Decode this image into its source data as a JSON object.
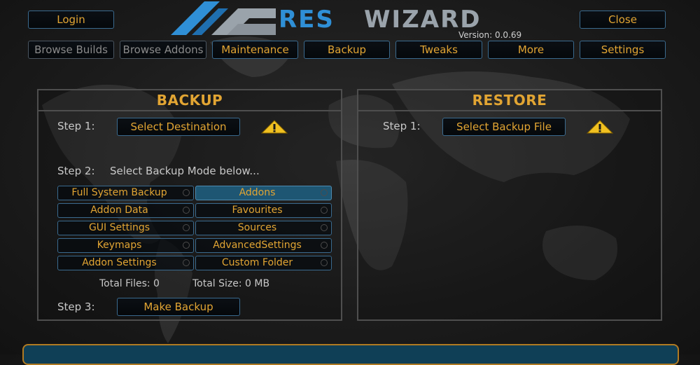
{
  "app": {
    "logo_left": "RES",
    "logo_right": "WIZARD",
    "version": "Version: 0.0.69"
  },
  "header": {
    "login_label": "Login",
    "close_label": "Close"
  },
  "nav": [
    {
      "label": "Browse Builds",
      "enabled": false
    },
    {
      "label": "Browse Addons",
      "enabled": false
    },
    {
      "label": "Maintenance",
      "enabled": true
    },
    {
      "label": "Backup",
      "enabled": true
    },
    {
      "label": "Tweaks",
      "enabled": true
    },
    {
      "label": "More",
      "enabled": true
    },
    {
      "label": "Settings",
      "enabled": true
    }
  ],
  "backup": {
    "title": "BACKUP",
    "step1_label": "Step 1:",
    "select_destination": "Select Destination",
    "step2_label": "Step 2:",
    "step2_text": "Select Backup Mode below...",
    "modes": [
      {
        "label": "Full System Backup",
        "selected": false
      },
      {
        "label": "Addons",
        "selected": true
      },
      {
        "label": "Addon Data",
        "selected": false
      },
      {
        "label": "Favourites",
        "selected": false
      },
      {
        "label": "GUI Settings",
        "selected": false
      },
      {
        "label": "Sources",
        "selected": false
      },
      {
        "label": "Keymaps",
        "selected": false
      },
      {
        "label": "AdvancedSettings",
        "selected": false
      },
      {
        "label": "Addon Settings",
        "selected": false
      },
      {
        "label": "Custom Folder",
        "selected": false
      }
    ],
    "total_files": "Total Files:  0",
    "total_size": "Total Size:  0 MB",
    "step3_label": "Step 3:",
    "make_backup": "Make Backup"
  },
  "restore": {
    "title": "RESTORE",
    "step1_label": "Step 1:",
    "select_backup_file": "Select Backup File"
  },
  "colors": {
    "accent_gold": "#e2a533",
    "button_border": "#3a6a8e",
    "selected_bg": "#1e5673",
    "logo_blue": "#2f8fd6"
  },
  "icons": [
    "warning-icon",
    "radio-indicator"
  ]
}
